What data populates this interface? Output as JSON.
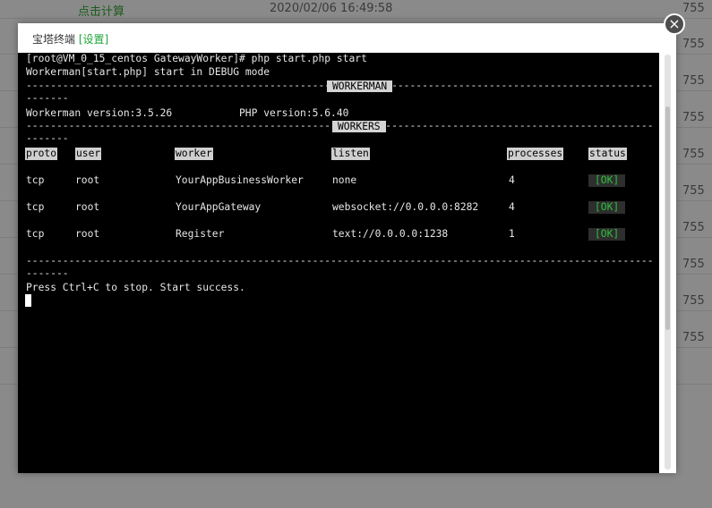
{
  "background": {
    "first_row": {
      "link": "点击计算",
      "time": "2020/02/06 16:49:58"
    },
    "numbers": [
      "755",
      "755",
      "755",
      "755",
      "755",
      "755",
      "755",
      "755",
      "755",
      "755"
    ]
  },
  "dialog": {
    "title": "宝塔终端",
    "settings": "[设置]",
    "close": "×"
  },
  "terminal": {
    "prompt_line": "[root@VM_0_15_centos GatewayWorker]# php start.php start",
    "start_line": "Workerman[start.php] start in DEBUG mode",
    "dashes_top": "-------------------------------------------------------------------------------------------------------------",
    "dashes_short": "-------",
    "workerman_tag": "WORKERMAN",
    "workers_tag": "WORKERS",
    "version_left": "Workerman version:3.5.26",
    "version_right": "PHP version:5.6.40",
    "headers": [
      "proto",
      "user",
      "worker",
      "listen",
      "processes",
      "status"
    ],
    "rows": [
      {
        "proto": "tcp",
        "user": "root",
        "worker": "YourAppBusinessWorker",
        "listen": "none",
        "processes": "4",
        "status": "[OK]"
      },
      {
        "proto": "tcp",
        "user": "root",
        "worker": "YourAppGateway",
        "listen": "websocket://0.0.0.0:8282",
        "processes": "4",
        "status": "[OK]"
      },
      {
        "proto": "tcp",
        "user": "root",
        "worker": "Register",
        "listen": "text://0.0.0.0:1238",
        "processes": "1",
        "status": "[OK]"
      }
    ],
    "success_line": "Press Ctrl+C to stop. Start success."
  },
  "colors": {
    "accent": "#20a53a",
    "ok_green": "#2fc03e",
    "terminal_bg": "#000000"
  }
}
